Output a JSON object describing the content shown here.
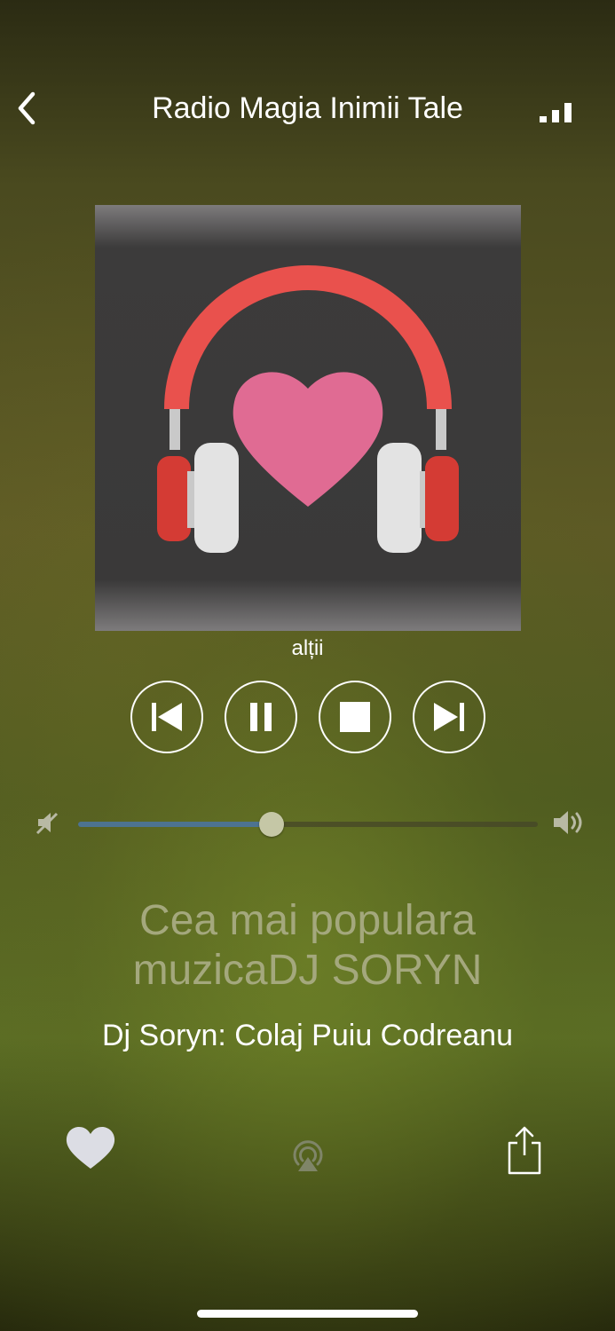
{
  "header": {
    "title": "Radio Magia Inimii Tale",
    "back_icon": "chevron-left-icon",
    "signal_icon": "signal-bars-icon"
  },
  "artwork": {
    "icon": "headphones-heart-icon",
    "colors": {
      "background": "#3a3939",
      "band": "#e9514d",
      "ear_cup": "#d43b34",
      "cushion": "#e3e3e3",
      "heart": "#e06b93"
    }
  },
  "genre": "alții",
  "controls": {
    "previous_icon": "previous-icon",
    "pause_icon": "pause-icon",
    "stop_icon": "stop-icon",
    "next_icon": "next-icon"
  },
  "volume": {
    "level": 0.42,
    "min_icon": "volume-mute-icon",
    "max_icon": "volume-high-icon",
    "fill_color": "#4d7390"
  },
  "now_playing": {
    "station": "Cea mai populara muzicaDJ SORYN",
    "track": "Dj Soryn: Colaj Puiu Codreanu"
  },
  "bottom_bar": {
    "favorite_icon": "heart-icon",
    "airplay_icon": "airplay-icon",
    "share_icon": "share-icon"
  }
}
